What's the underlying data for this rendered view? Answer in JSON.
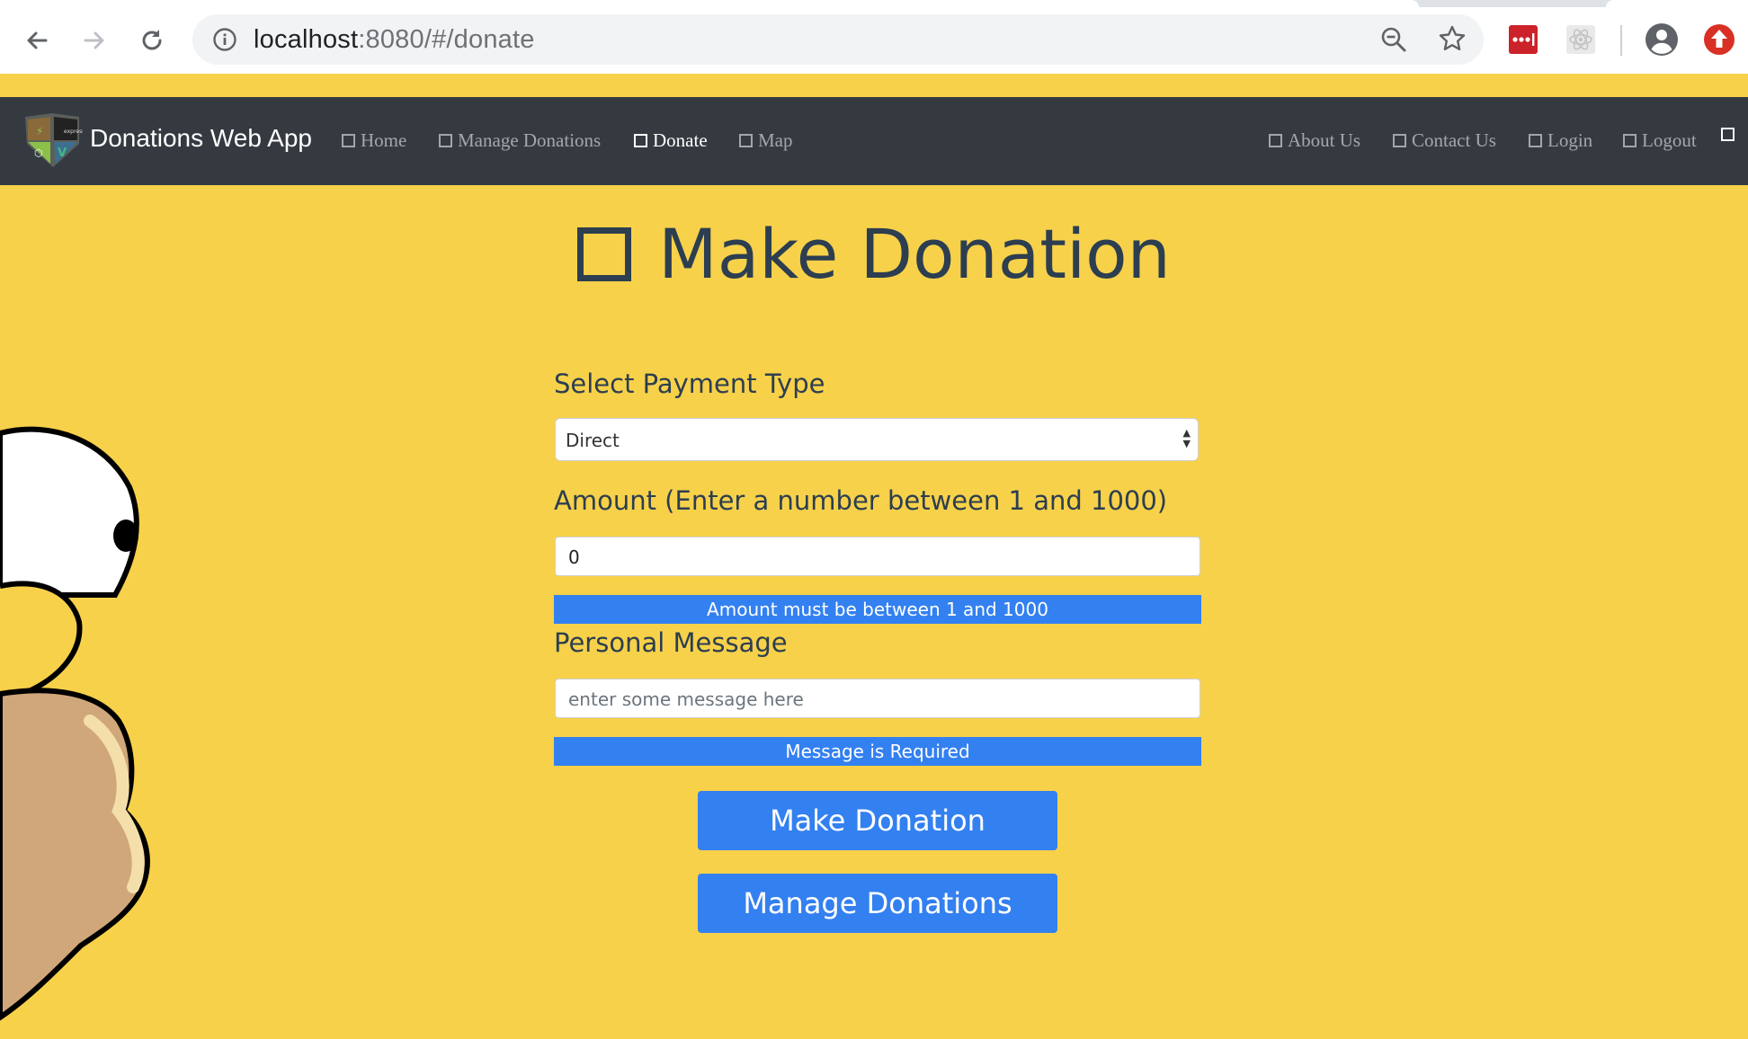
{
  "browser": {
    "url_host": "localhost",
    "url_path": ":8080/#/donate",
    "icons": [
      "back-icon",
      "forward-icon",
      "reload-icon",
      "info-icon",
      "zoom-out-icon",
      "star-icon",
      "password-manager-icon",
      "react-devtools-icon",
      "profile-icon",
      "update-icon"
    ]
  },
  "navbar": {
    "brand": "Donations Web App",
    "left_items": [
      {
        "label": "Home"
      },
      {
        "label": "Manage Donations"
      },
      {
        "label": "Donate"
      },
      {
        "label": "Map"
      }
    ],
    "right_items": [
      {
        "label": "About Us"
      },
      {
        "label": "Contact Us"
      },
      {
        "label": "Login"
      },
      {
        "label": "Logout"
      }
    ]
  },
  "page": {
    "title": "Make Donation"
  },
  "form": {
    "payment_label": "Select Payment Type",
    "payment_value": "Direct",
    "amount_label": "Amount (Enter a number between 1 and 1000)",
    "amount_value": "0",
    "amount_error": "Amount must be between 1 and 1000",
    "message_label": "Personal Message",
    "message_placeholder": "enter some message here",
    "message_error": "Message is Required",
    "submit_label": "Make Donation",
    "manage_label": "Manage Donations"
  },
  "colors": {
    "page_bg": "#f7d14a",
    "navbar_bg": "#343a40",
    "primary": "#3380f0",
    "heading": "#2c3e50"
  }
}
